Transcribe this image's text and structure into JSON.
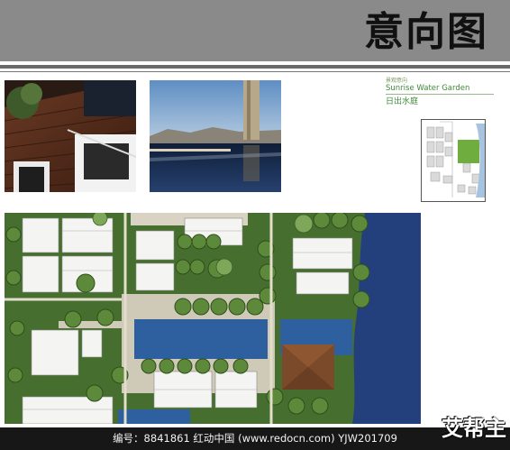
{
  "header": {
    "title": "意向图"
  },
  "panel": {
    "section_label": "景观意向",
    "title_en": "Sunrise Water Garden",
    "title_cn": "日出水庭"
  },
  "photos": [
    {
      "name": "wooden-deck-terrace"
    },
    {
      "name": "reflecting-pool-landscape"
    }
  ],
  "footer": {
    "text": "编号：8841861    红动中国 (www.redocn.com)    YJW201709"
  },
  "watermark": {
    "logo_text": "艾帮主"
  },
  "colors": {
    "header": "#8a8a8a",
    "water": "#2e5f9e",
    "plan_green": "#3d6a2c",
    "footer": "#171717"
  }
}
